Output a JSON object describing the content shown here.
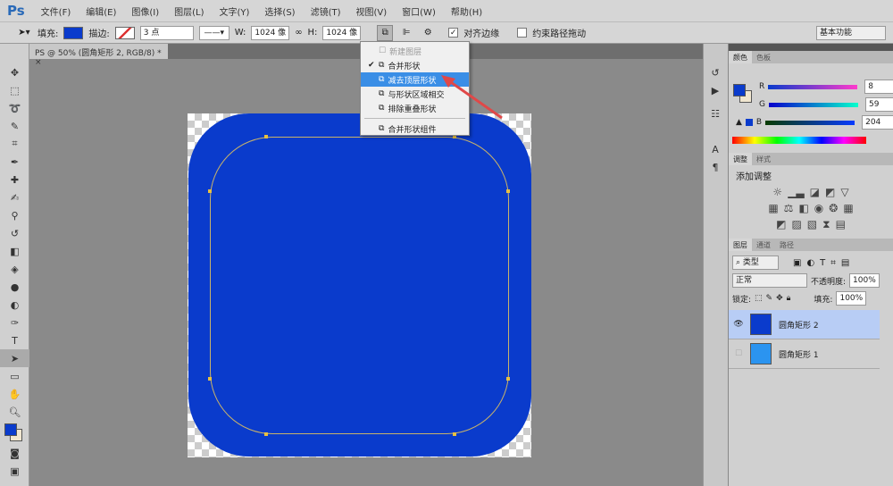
{
  "app": {
    "logo": "Ps"
  },
  "menu": [
    "文件(F)",
    "编辑(E)",
    "图像(I)",
    "图层(L)",
    "文字(Y)",
    "选择(S)",
    "滤镜(T)",
    "视图(V)",
    "窗口(W)",
    "帮助(H)"
  ],
  "options": {
    "fill_label": "填充:",
    "stroke_label": "描边:",
    "stroke_width": "3 点",
    "w_label": "W:",
    "w_value": "1024 像",
    "h_label": "H:",
    "h_value": "1024 像",
    "align_edges": "对齐边缘",
    "constrain_path": "约束路径拖动",
    "workspace": "基本功能",
    "fill_color": "#0a3bcc"
  },
  "document_tab": "PS @ 50% (圆角矩形 2, RGB/8) *",
  "path_ops_menu": {
    "items": [
      {
        "label": "新建图层",
        "disabled": true
      },
      {
        "label": "合并形状",
        "checked": true
      },
      {
        "label": "减去顶层形状",
        "selected": true
      },
      {
        "label": "与形状区域相交"
      },
      {
        "label": "排除重叠形状"
      },
      {
        "label": "合并形状组件"
      }
    ]
  },
  "color_panel": {
    "tabs": [
      "颜色",
      "色板"
    ],
    "r_label": "R",
    "g_label": "G",
    "b_label": "B",
    "r": "8",
    "g": "59",
    "b": "204"
  },
  "adjust_panel": {
    "tabs": [
      "调整",
      "样式"
    ],
    "title": "添加调整"
  },
  "layers_panel": {
    "tabs": [
      "图层",
      "通道",
      "路径"
    ],
    "filter": "类型",
    "blend": "正常",
    "opacity_label": "不透明度:",
    "opacity": "100%",
    "lock_label": "锁定:",
    "fill_label": "填充:",
    "fill": "100%",
    "layers": [
      {
        "name": "圆角矩形 2",
        "color": "#0a3bcc",
        "selected": true,
        "visible": true
      },
      {
        "name": "圆角矩形 1",
        "color": "#2b94f0",
        "selected": false,
        "visible": false
      }
    ]
  }
}
